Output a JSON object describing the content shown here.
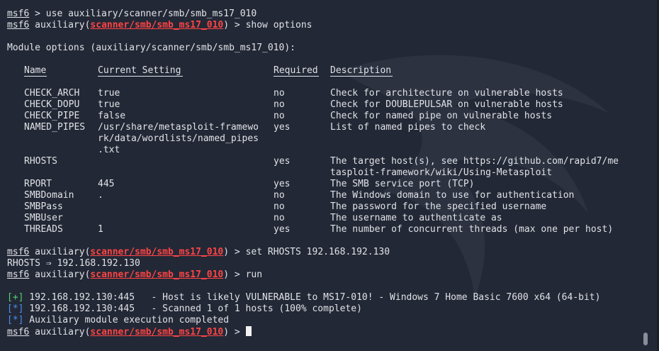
{
  "prompt": {
    "msf": "msf6",
    "aux": "auxiliary",
    "module": "scanner/smb/smb_ms17_010"
  },
  "commands": {
    "cmd1": " > use auxiliary/scanner/smb/smb_ms17_010",
    "cmd2": " > show options",
    "cmd3": " > set RHOSTS 192.168.192.130",
    "cmd4": " > run",
    "cmd5": " > "
  },
  "module_options_title": "Module options (auxiliary/scanner/smb/smb_ms17_010):",
  "table": {
    "headers": {
      "name": "Name",
      "setting": "Current Setting",
      "required": "Required",
      "description": "Description"
    },
    "rows": [
      {
        "name": "CHECK_ARCH",
        "setting": [
          "true"
        ],
        "required": "no",
        "description": [
          "Check for architecture on vulnerable hosts"
        ]
      },
      {
        "name": "CHECK_DOPU",
        "setting": [
          "true"
        ],
        "required": "no",
        "description": [
          "Check for DOUBLEPULSAR on vulnerable hosts"
        ]
      },
      {
        "name": "CHECK_PIPE",
        "setting": [
          "false"
        ],
        "required": "no",
        "description": [
          "Check for named pipe on vulnerable hosts"
        ]
      },
      {
        "name": "NAMED_PIPES",
        "setting": [
          "/usr/share/metasploit-framewo",
          "rk/data/wordlists/named_pipes",
          ".txt"
        ],
        "required": "yes",
        "description": [
          "List of named pipes to check"
        ]
      },
      {
        "name": "RHOSTS",
        "setting": [
          ""
        ],
        "required": "yes",
        "description": [
          "The target host(s), see https://github.com/rapid7/me",
          "tasploit-framework/wiki/Using-Metasploit"
        ]
      },
      {
        "name": "RPORT",
        "setting": [
          "445"
        ],
        "required": "yes",
        "description": [
          "The SMB service port (TCP)"
        ]
      },
      {
        "name": "SMBDomain",
        "setting": [
          "."
        ],
        "required": "no",
        "description": [
          "The Windows domain to use for authentication"
        ]
      },
      {
        "name": "SMBPass",
        "setting": [
          ""
        ],
        "required": "no",
        "description": [
          "The password for the specified username"
        ]
      },
      {
        "name": "SMBUser",
        "setting": [
          ""
        ],
        "required": "no",
        "description": [
          "The username to authenticate as"
        ]
      },
      {
        "name": "THREADS",
        "setting": [
          "1"
        ],
        "required": "yes",
        "description": [
          "The number of concurrent threads (max one per host)"
        ]
      }
    ]
  },
  "rhosts_echo": "RHOSTS ⇒ 192.168.192.130",
  "results": [
    {
      "tag": "[+]",
      "color": "green",
      "text": " 192.168.192.130:445   - Host is likely VULNERABLE to MS17-010! - Windows 7 Home Basic 7600 x64 (64-bit)"
    },
    {
      "tag": "[*]",
      "color": "blue",
      "text": " 192.168.192.130:445   - Scanned 1 of 1 hosts (100% complete)"
    },
    {
      "tag": "[*]",
      "color": "blue",
      "text": " Auxiliary module execution completed"
    }
  ],
  "colors": {
    "background": "#232836",
    "foreground": "#e0e2e6",
    "module": "#ff4444",
    "info": "#4d8ff0",
    "success": "#4fd36b"
  }
}
